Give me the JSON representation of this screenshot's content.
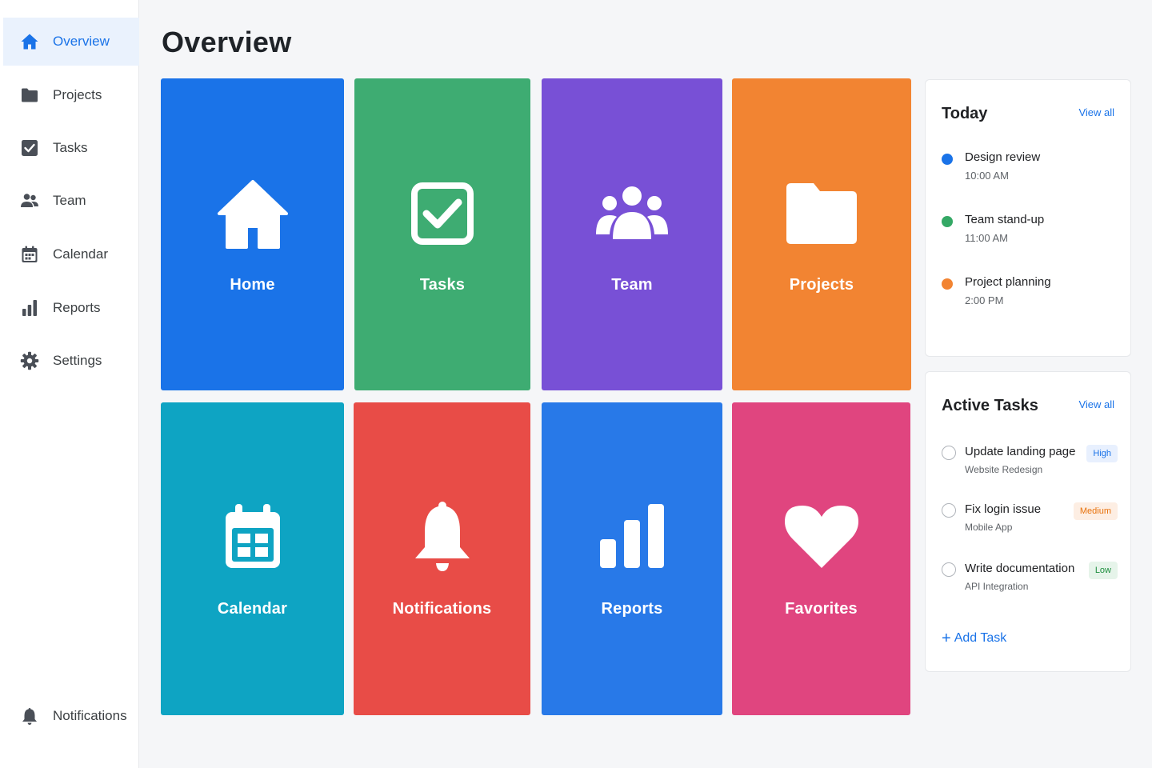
{
  "sidebar": {
    "items": [
      {
        "label": "Overview",
        "icon": "home-icon"
      },
      {
        "label": "Projects",
        "icon": "folder-icon"
      },
      {
        "label": "Tasks",
        "icon": "checkbox-icon"
      },
      {
        "label": "Team",
        "icon": "people-icon"
      },
      {
        "label": "Calendar",
        "icon": "calendar-icon"
      },
      {
        "label": "Reports",
        "icon": "bar-chart-icon"
      },
      {
        "label": "Settings",
        "icon": "gear-icon"
      }
    ],
    "bottom_item": {
      "label": "Notifications",
      "icon": "bell-icon"
    }
  },
  "main": {
    "title": "Overview",
    "tiles": [
      {
        "label": "Home",
        "icon": "home-icon",
        "color": "#1a73e8"
      },
      {
        "label": "Tasks",
        "icon": "checkbox-icon",
        "color": "#3eac72"
      },
      {
        "label": "Team",
        "icon": "people-icon",
        "color": "#7850d6"
      },
      {
        "label": "Projects",
        "icon": "folder-icon",
        "color": "#f28432"
      },
      {
        "label": "Calendar",
        "icon": "calendar-icon",
        "color": "#0ea4c3"
      },
      {
        "label": "Notifications",
        "icon": "bell-icon",
        "color": "#e84c47"
      },
      {
        "label": "Reports",
        "icon": "bar-chart-icon",
        "color": "#2879e8"
      },
      {
        "label": "Favorites",
        "icon": "heart-icon",
        "color": "#e0457f"
      }
    ]
  },
  "today": {
    "title": "Today",
    "view_all": "View all",
    "events": [
      {
        "name": "Design review",
        "time": "10:00 AM",
        "color": "#1a73e8"
      },
      {
        "name": "Team stand-up",
        "time": "11:00 AM",
        "color": "#34a865"
      },
      {
        "name": "Project planning",
        "time": "2:00 PM",
        "color": "#f28432"
      }
    ]
  },
  "active_tasks": {
    "title": "Active Tasks",
    "view_all": "View all",
    "tasks": [
      {
        "name": "Update landing page",
        "project": "Website Redesign",
        "priority": "High"
      },
      {
        "name": "Fix login issue",
        "project": "Mobile App",
        "priority": "Medium"
      },
      {
        "name": "Write documentation",
        "project": "API Integration",
        "priority": "Low"
      }
    ],
    "add_label": "Add Task"
  },
  "colors": {
    "accent": "#1a73e8",
    "sidebar_icon": "#4a4f57",
    "active_nav_bg": "#eaf2fd"
  }
}
